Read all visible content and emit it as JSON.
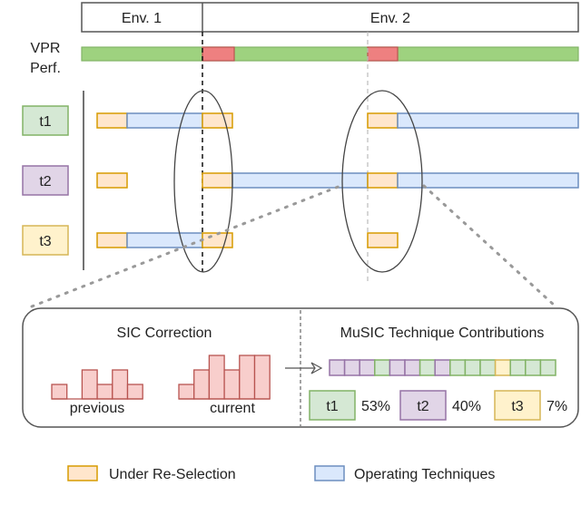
{
  "header": {
    "env1": "Env. 1",
    "env2": "Env. 2"
  },
  "vpr_label": [
    "VPR",
    "Perf."
  ],
  "techniques": [
    {
      "label": "t1",
      "fill": "#d5e8d4",
      "stroke": "#82b366"
    },
    {
      "label": "t2",
      "fill": "#e1d5e7",
      "stroke": "#9673a6"
    },
    {
      "label": "t3",
      "fill": "#fff2cc",
      "stroke": "#d6b656"
    }
  ],
  "colors": {
    "reselect_fill": "#ffe6cc",
    "reselect_stroke": "#d79b00",
    "operating_fill": "#dae8fc",
    "operating_stroke": "#6c8ebf",
    "vpr_good": "#9ed27f",
    "vpr_bad": "#ee8080",
    "hist_fill": "#f8cecc",
    "hist_stroke": "#b85450"
  },
  "panel": {
    "sic_title": "SIC Correction",
    "previous_label": "previous",
    "current_label": "current",
    "previous_hist": [
      1,
      0,
      2,
      1,
      2,
      1
    ],
    "current_hist": [
      1,
      2,
      3,
      2,
      3,
      3
    ],
    "music_title": "MuSIC Technique Contributions",
    "contribution_sequence": [
      "t2",
      "t2",
      "t2",
      "t1",
      "t2",
      "t2",
      "t1",
      "t2",
      "t1",
      "t1",
      "t1",
      "t3",
      "t1",
      "t1",
      "t1"
    ],
    "contributions": [
      {
        "label": "t1",
        "percent": "53%"
      },
      {
        "label": "t2",
        "percent": "40%"
      },
      {
        "label": "t3",
        "percent": "7%"
      }
    ]
  },
  "legend": {
    "reselect": "Under Re-Selection",
    "operating": "Operating Techniques"
  }
}
